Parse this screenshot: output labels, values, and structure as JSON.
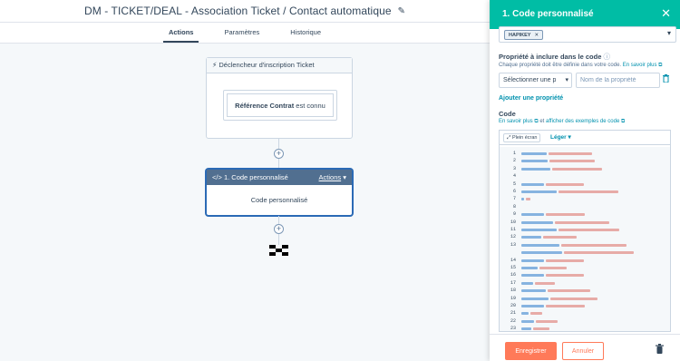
{
  "workflow": {
    "title": "DM - TICKET/DEAL - Association Ticket / Contact automatique",
    "tabs": [
      {
        "label": "Actions"
      },
      {
        "label": "Paramètres"
      },
      {
        "label": "Historique"
      }
    ],
    "trigger": {
      "header": "Déclencheur d'inscription Ticket",
      "condition_bold": "Référence Contrat",
      "condition_rest": " est connu"
    },
    "action": {
      "header": "1. Code personnalisé",
      "menu_label": "Actions",
      "body": "Code personnalisé"
    }
  },
  "panel": {
    "title": "1. Code personnalisé",
    "secret_chip": "HAPIKEY",
    "properties": {
      "label": "Propriété à inclure dans le code",
      "help": "Chaque propriété doit être définie dans votre code.",
      "help_link": "En savoir plus",
      "select_value": "Sélectionner une p",
      "name_placeholder": "Nom de la propriété"
    },
    "add_property": "Ajouter une propriété",
    "code": {
      "label": "Code",
      "learn_more": "En savoir plus",
      "and": "et",
      "examples": "afficher des exemples de code",
      "fullscreen": "Plein écran",
      "theme": "Léger",
      "line_numbers": [
        "1",
        "2",
        "3",
        "4",
        "5",
        "6",
        "7",
        "8",
        "9",
        "10",
        "11",
        "12",
        "13",
        "",
        "14",
        "15",
        "16",
        "17",
        "18",
        "19",
        "20",
        "21",
        "22",
        "23"
      ]
    },
    "footer": {
      "save": "Enregistrer",
      "cancel": "Annuler"
    }
  },
  "colors": {
    "accent": "#00bda5",
    "primary_button": "#ff7a59",
    "link": "#0091ae",
    "action_header": "#516f90",
    "code_string": "#d2372a",
    "code_keyword": "#0060c0"
  }
}
